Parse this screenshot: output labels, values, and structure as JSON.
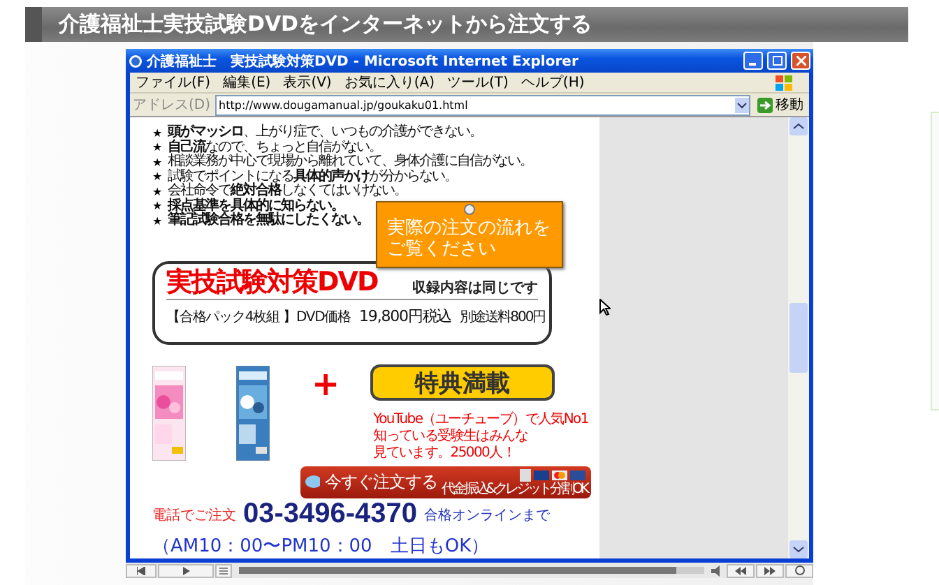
{
  "header": {
    "title": "介護福祉士実技試験DVDをインターネットから注文する"
  },
  "browser": {
    "title": "介護福祉士　実技試験対策DVD - Microsoft Internet Explorer",
    "menu": [
      "ファイル(F)",
      "編集(E)",
      "表示(V)",
      "お気に入り(A)",
      "ツール(T)",
      "ヘルプ(H)"
    ],
    "address_label": "アドレス(D)",
    "url": "http://www.dougamanual.jp/goukaku01.html",
    "go_label": "移動"
  },
  "page": {
    "points": [
      {
        "text": "**頭がマッシロ**、上がり症で、いつもの介護ができない。",
        "bold": false
      },
      {
        "text": "**自己流**なので、ちょっと自信がない。",
        "bold": false
      },
      {
        "text": "相談業務が中心で現場から離れていて、身体介護に自信がない。",
        "bold": false
      },
      {
        "text": "試験でポイントになる**具体的声かけ**が分からない。",
        "bold": false
      },
      {
        "text": "会社命令で**絶対合格**しなくてはいけない。",
        "bold": false
      },
      {
        "text": "採点基準を具体的に知らない。",
        "bold": true
      },
      {
        "text": "筆記試験合格を無駄にしたくない。",
        "bold": true
      }
    ],
    "star": "★",
    "callout": {
      "lines": [
        "実際の注文の流れを",
        "ご覧ください"
      ]
    },
    "product": {
      "title": "実技試験対策DVD",
      "note": "収録内容は同じです",
      "pack": "【合格パック4枚組 】DVD価格",
      "price": "19,800円税込",
      "shipping": "別途送料800円"
    },
    "plus": "+",
    "bonus": "特典満載",
    "promo": [
      "YouTube（ユーチューブ）で人気No1",
      "知っている受験生はみんな",
      "見ています。25000人！"
    ],
    "order": {
      "label": "今すぐ注文する",
      "note": "代金振込&クレジット分割OK"
    },
    "phone": {
      "label": "電話でご注文",
      "number": "03-3496-4370",
      "suffix": "合格オンラインまで",
      "hours": "（AM10：00〜PM10：00　土日もOK）"
    }
  },
  "player": {
    "level": 0.94
  }
}
